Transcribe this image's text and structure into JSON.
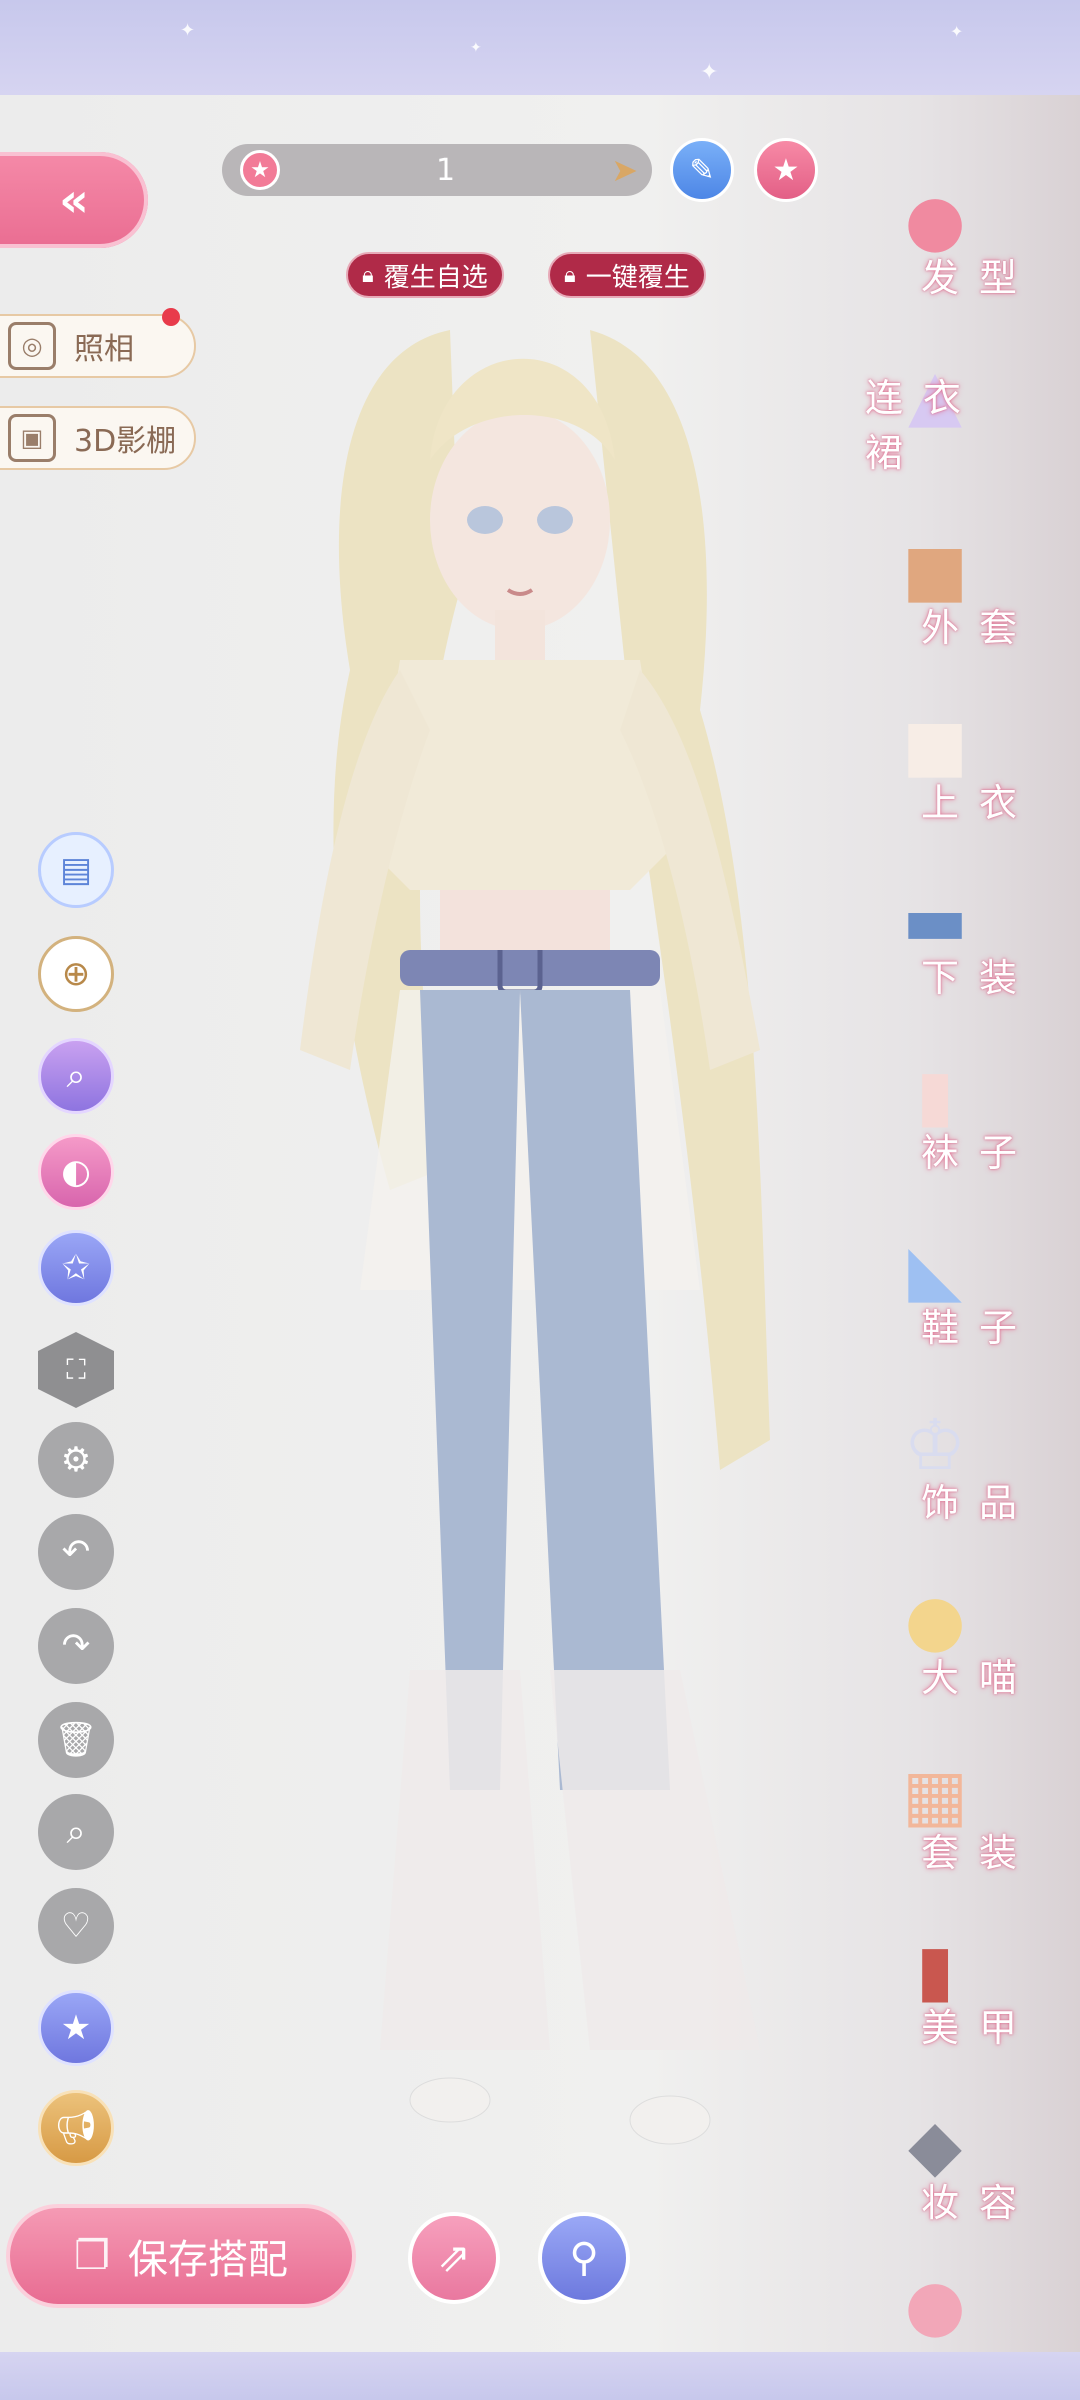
{
  "top_bar": {
    "counter_value": "1",
    "star_icon": "star-icon",
    "arrow_icon": "send-arrow-icon",
    "edit_icon": "pencil-icon",
    "favorite_icon": "star-icon"
  },
  "left_panel": {
    "back_icon": "double-chevron-left-icon",
    "photo_label": "照相",
    "studio_label": "3D影棚"
  },
  "lock_tags": {
    "rebirth_select": "覆生自选",
    "rebirth_one_click": "一键覆生"
  },
  "tools": [
    {
      "name": "outfit-card-icon"
    },
    {
      "name": "layer-add-icon"
    },
    {
      "name": "search-adjust-icon"
    },
    {
      "name": "palette-icon"
    },
    {
      "name": "star-wand-icon"
    },
    {
      "name": "fullscreen-icon"
    },
    {
      "name": "settings-icon"
    },
    {
      "name": "undo-icon"
    },
    {
      "name": "redo-icon"
    },
    {
      "name": "trash-icon"
    },
    {
      "name": "zoom-icon"
    },
    {
      "name": "heart-icon"
    },
    {
      "name": "star-badge-icon"
    },
    {
      "name": "megaphone-icon"
    }
  ],
  "categories": [
    {
      "label": "发型",
      "icon": "hair-icon"
    },
    {
      "label": "连衣裙",
      "icon": "dress-icon"
    },
    {
      "label": "外套",
      "icon": "coat-icon"
    },
    {
      "label": "上衣",
      "icon": "shirt-icon"
    },
    {
      "label": "下装",
      "icon": "shorts-icon"
    },
    {
      "label": "袜子",
      "icon": "sock-icon"
    },
    {
      "label": "鞋子",
      "icon": "shoe-icon"
    },
    {
      "label": "饰品",
      "icon": "tiara-icon"
    },
    {
      "label": "大喵",
      "icon": "cat-icon"
    },
    {
      "label": "套装",
      "icon": "outfit-set-icon"
    },
    {
      "label": "美甲",
      "icon": "nail-polish-icon"
    },
    {
      "label": "妆容",
      "icon": "makeup-palette-icon"
    }
  ],
  "bottom": {
    "save_label": "保存搭配",
    "share_icon": "share-icon",
    "wardrobe_icon": "wardrobe-icon"
  },
  "colors": {
    "accent_pink": "#e86c92",
    "accent_blue": "#6f77df",
    "lock_red": "#b02a48",
    "background": "#efefee"
  }
}
